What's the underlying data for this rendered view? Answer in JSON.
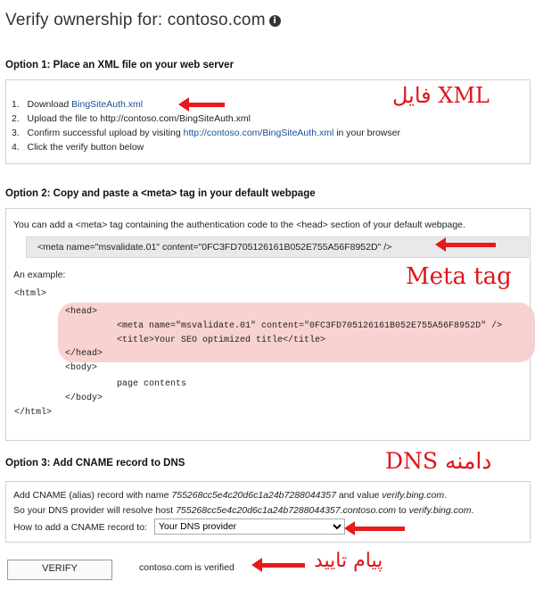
{
  "header": {
    "title": "Verify ownership for: contoso.com",
    "info_glyph": "i"
  },
  "option1": {
    "title": "Option 1: Place an XML file on your web server",
    "steps": [
      {
        "num": "1.",
        "pre": "Download ",
        "link": "BingSiteAuth.xml",
        "post": ""
      },
      {
        "num": "2.",
        "pre": "Upload the file to http://contoso.com/BingSiteAuth.xml",
        "link": "",
        "post": ""
      },
      {
        "num": "3.",
        "pre": "Confirm successful upload by visiting ",
        "link": "http://contoso.com/BingSiteAuth.xml",
        "post": " in your browser"
      },
      {
        "num": "4.",
        "pre": "Click the verify button below",
        "link": "",
        "post": ""
      }
    ]
  },
  "option2": {
    "title": "Option 2: Copy and paste a <meta> tag in your default webpage",
    "intro": "You can add a <meta> tag containing the authentication code to the <head> section of your default webpage.",
    "meta_tag": "<meta name=\"msvalidate.01\" content=\"0FC3FD705126161B052E755A56F8952D\" />",
    "example_label": "An example:",
    "code": {
      "html_open": "<html>",
      "head_open": "<head>",
      "meta": "<meta name=\"msvalidate.01\" content=\"0FC3FD705126161B052E755A56F8952D\" />",
      "title": "<title>Your SEO optimized title</title>",
      "head_close": "</head>",
      "body_open": "<body>",
      "contents": "page contents",
      "body_close": "</body>",
      "html_close": "</html>"
    }
  },
  "option3": {
    "title": "Option 3: Add CNAME record to DNS",
    "line1_pre": "Add CNAME (alias) record with name ",
    "line1_name": "755268cc5e4c20d6c1a24b7288044357",
    "line1_mid": " and value ",
    "line1_value": "verify.bing.com",
    "line1_post": ".",
    "line2_pre": "So your DNS provider will resolve host ",
    "line2_host": "755268cc5e4c20d6c1a24b7288044357.contoso.com",
    "line2_mid": " to ",
    "line2_value": "verify.bing.com",
    "line2_post": ".",
    "howto_label": "How to add a CNAME record to:",
    "provider_selected": "Your DNS provider"
  },
  "footer": {
    "verify_button": "VERIFY",
    "status": "contoso.com is verified"
  },
  "annotations": {
    "xml": "فایل XML",
    "meta": "Meta tag",
    "dns": "DNS دامنه",
    "verified": "پیام تایید"
  },
  "colors": {
    "arrow": "#e81a1a",
    "annotation": "#e0141a",
    "highlight": "#f7c9c9",
    "link": "#1a4f95"
  },
  "icons": {
    "info": "info-icon",
    "arrow": "arrow-left-icon",
    "dropdown": "chevron-down-icon"
  }
}
